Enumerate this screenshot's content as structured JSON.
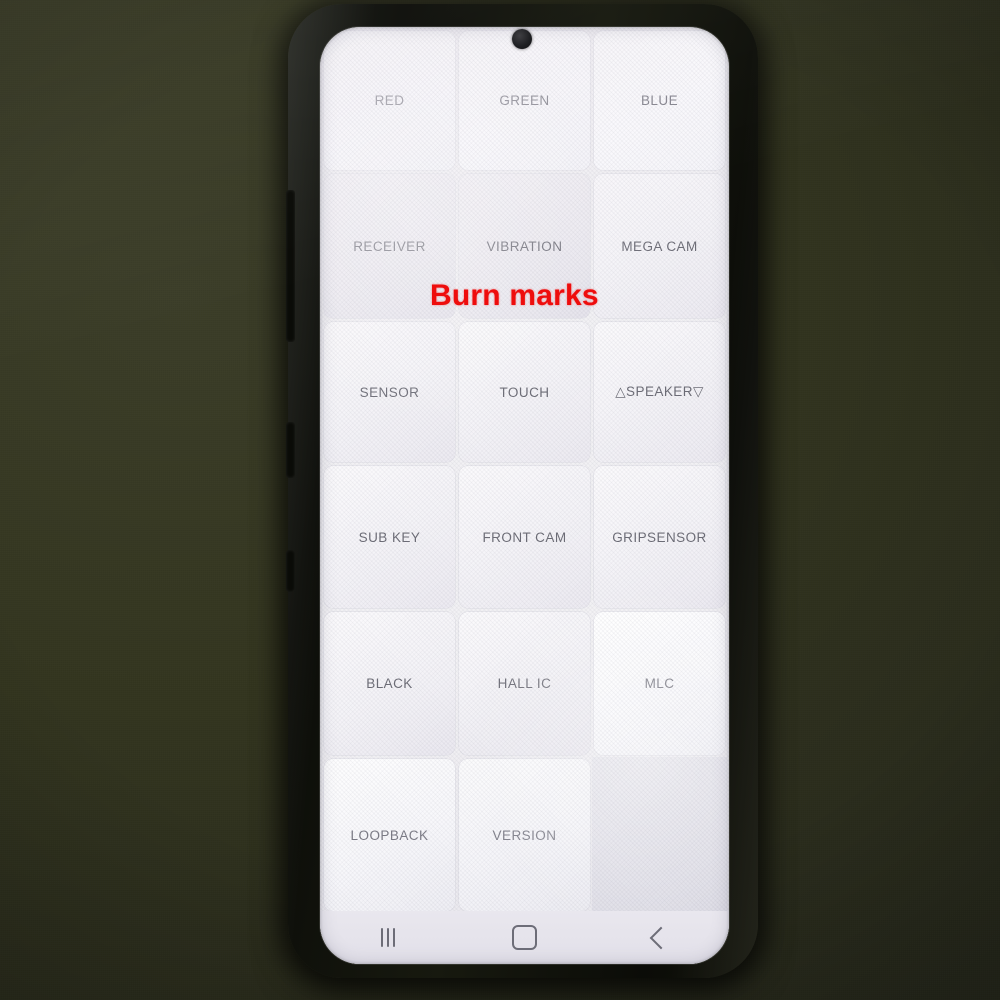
{
  "scene": {
    "background_color": "#333524",
    "phone_body_color": "#101208",
    "screen_background": "#f2f1f4"
  },
  "annotation": {
    "text": "Burn marks",
    "color": "#ee0d0d"
  },
  "screen": {
    "camera": "punch-hole-front-camera",
    "grid": {
      "columns": 3,
      "rows": 6,
      "cells": [
        {
          "label": "RED",
          "state": "bright"
        },
        {
          "label": "GREEN",
          "state": "bright"
        },
        {
          "label": "BLUE",
          "state": "bright"
        },
        {
          "label": "RECEIVER",
          "state": "dim"
        },
        {
          "label": "VIBRATION",
          "state": "dim"
        },
        {
          "label": "MEGA CAM",
          "state": "normal"
        },
        {
          "label": "SENSOR",
          "state": "normal"
        },
        {
          "label": "TOUCH",
          "state": "normal"
        },
        {
          "label": "△SPEAKER▽",
          "state": "normal"
        },
        {
          "label": "SUB KEY",
          "state": "normal"
        },
        {
          "label": "FRONT CAM",
          "state": "normal"
        },
        {
          "label": "GRIPSENSOR",
          "state": "normal"
        },
        {
          "label": "BLACK",
          "state": "normal"
        },
        {
          "label": "HALL IC",
          "state": "normal"
        },
        {
          "label": "MLC",
          "state": "bright"
        },
        {
          "label": "LOOPBACK",
          "state": "bright"
        },
        {
          "label": "VERSION",
          "state": "bright"
        },
        {
          "label": "",
          "state": "empty"
        }
      ]
    },
    "navbar": {
      "recents_label": "recents-icon",
      "home_label": "home-icon",
      "back_label": "back-icon"
    }
  }
}
